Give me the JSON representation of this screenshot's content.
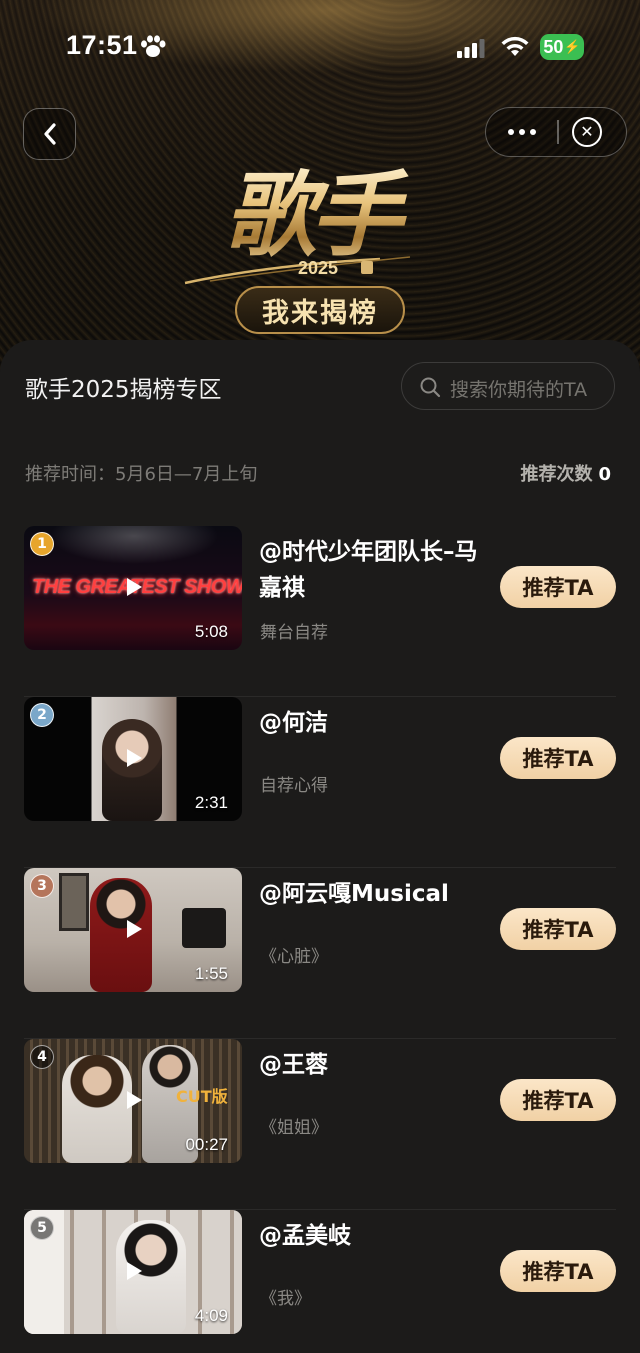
{
  "status_bar": {
    "time": "17:51",
    "battery": "50"
  },
  "logo": {
    "title": "歌手",
    "year": "2025",
    "subtitle": "我来揭榜"
  },
  "section": {
    "title": "歌手2025揭榜专区"
  },
  "search": {
    "placeholder": "搜索你期待的TA"
  },
  "meta": {
    "time_label": "推荐时间：5月6日—7月上旬",
    "count_label": "推荐次数",
    "count_value": "0"
  },
  "items": [
    {
      "rank": "1",
      "name": "@时代少年团队长–马嘉祺",
      "sub": "舞台自荐",
      "duration": "5:08",
      "thumb_text": "THE GREATEST SHOW",
      "button": "推荐TA",
      "badge_color": "#e7a52c"
    },
    {
      "rank": "2",
      "name": "@何洁",
      "sub": "自荐心得",
      "duration": "2:31",
      "button": "推荐TA",
      "badge_color": "#7aa7c9"
    },
    {
      "rank": "3",
      "name": "@阿云嘎Musical",
      "sub": "《心脏》",
      "duration": "1:55",
      "button": "推荐TA",
      "badge_color": "#b5755b"
    },
    {
      "rank": "4",
      "name": "@王蓉",
      "sub": "《姐姐》",
      "duration": "00:27",
      "thumb_text": "CUT版",
      "button": "推荐TA"
    },
    {
      "rank": "5",
      "name": "@孟美岐",
      "sub": "《我》",
      "duration": "4:09",
      "button": "推荐TA"
    }
  ]
}
